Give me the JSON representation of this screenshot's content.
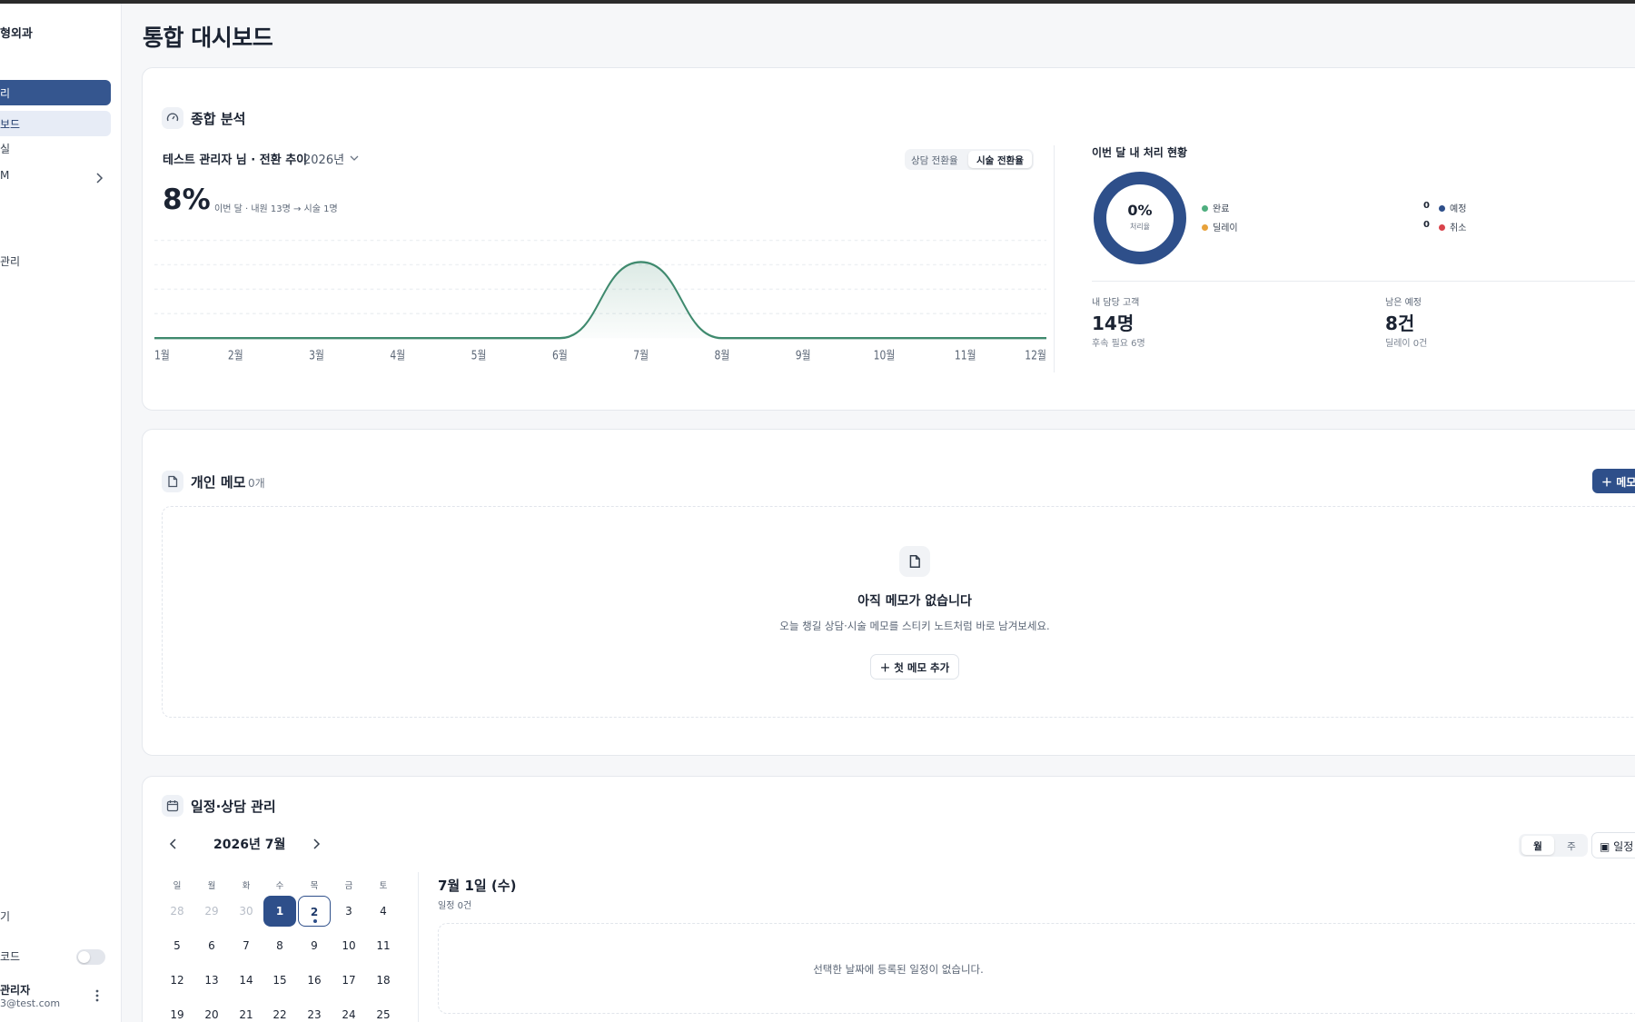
{
  "sidebar": {
    "clinic_name": "형외과",
    "active_item": "리",
    "sub_active_item": "보드",
    "items": [
      "실",
      "M",
      "관리"
    ],
    "bottom_item": "기",
    "dark_mode_label": "코드",
    "user_name": "관리자",
    "user_email": "3@test.com"
  },
  "page_title": "통합 대시보드",
  "analysis": {
    "section_title": "종합 분석",
    "trend_title": "테스트 관리자 님 · 전환 추이",
    "year": "2026년",
    "toggle": [
      "상담 전환율",
      "시술 전환율"
    ],
    "rate": "8%",
    "rate_desc": "이번 달 · 내원 13명 → 시술 1명"
  },
  "chart_data": {
    "type": "area",
    "categories": [
      "1월",
      "2월",
      "3월",
      "4월",
      "5월",
      "6월",
      "7월",
      "8월",
      "9월",
      "10월",
      "11월",
      "12월"
    ],
    "series": [
      {
        "values": [
          0,
          0,
          0,
          0,
          0,
          0,
          8,
          0,
          0,
          0,
          0,
          0
        ]
      }
    ],
    "ylim": [
      0,
      10
    ],
    "grid": true,
    "line_color": "#3f8a6e"
  },
  "status": {
    "title": "이번 달 내 처리 현황",
    "donut_pct": "0%",
    "donut_label": "처리율",
    "legend": [
      {
        "label": "완료",
        "color": "#4fae7f"
      },
      {
        "label": "딜레이",
        "color": "#e8a23b"
      },
      {
        "label": "예정",
        "color": "#2e4f8a",
        "value": "0"
      },
      {
        "label": "취소",
        "color": "#d9434b",
        "value": "0"
      }
    ],
    "my_customers_label": "내 담당 고객",
    "my_customers_value": "14명",
    "my_customers_sub": "후속 필요 6명",
    "remaining_label": "남은 예정",
    "remaining_value": "8건",
    "remaining_sub": "딜레이 0건"
  },
  "memo": {
    "section_title": "개인 메모",
    "count": "0개",
    "add_button": "메모",
    "empty_title": "아직 메모가 없습니다",
    "empty_desc": "오늘 챙길 상담·시술 메모를 스티키 노트처럼 바로 남겨보세요.",
    "first_button": "첫 메모 추가"
  },
  "schedule": {
    "section_title": "일정·상담 관리",
    "month": "2026년 7월",
    "dow": [
      "일",
      "월",
      "화",
      "수",
      "목",
      "금",
      "토"
    ],
    "weeks": [
      [
        "28",
        "29",
        "30",
        "1",
        "2",
        "3",
        "4"
      ],
      [
        "5",
        "6",
        "7",
        "8",
        "9",
        "10",
        "11"
      ],
      [
        "12",
        "13",
        "14",
        "15",
        "16",
        "17",
        "18"
      ],
      [
        "19",
        "20",
        "21",
        "22",
        "23",
        "24",
        "25"
      ]
    ],
    "selected_date": "7월 1일 (수)",
    "selected_count": "일정 0건",
    "empty_text": "선택한 날짜에 등록된 일정이 없습니다.",
    "view_month": "월",
    "view_week": "주",
    "add_button": "일정"
  }
}
